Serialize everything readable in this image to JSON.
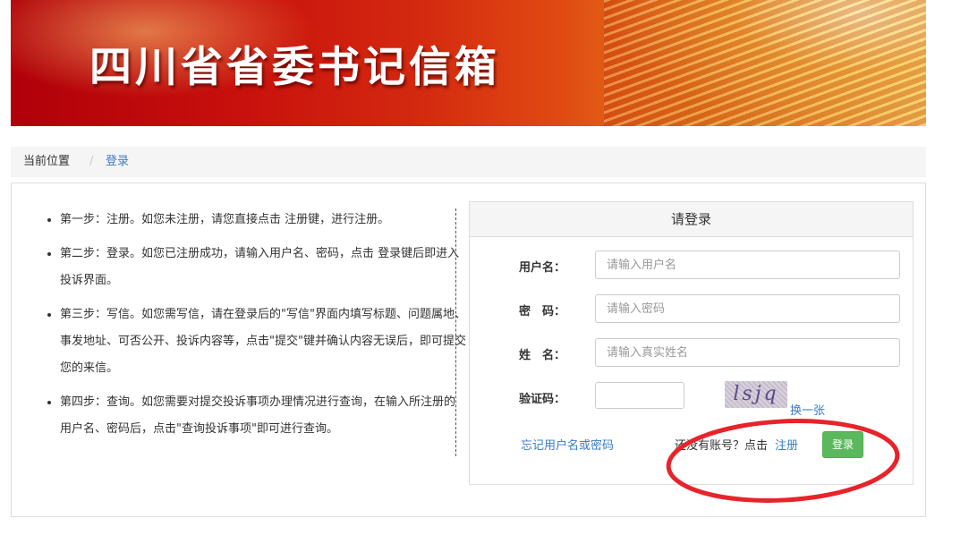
{
  "banner": {
    "title": "四川省省委书记信箱"
  },
  "breadcrumb": {
    "current_label": "当前位置",
    "separator": "/",
    "page": "登录"
  },
  "steps": [
    "第一步：注册。如您未注册，请您直接点击 注册键，进行注册。",
    "第二步：登录。如您已注册成功，请输入用户名、密码，点击 登录键后即进入投诉界面。",
    "第三步：写信。如您需写信，请在登录后的\"写信\"界面内填写标题、问题属地、事发地址、可否公开、投诉内容等，点击\"提交\"键并确认内容无误后，即可提交您的来信。",
    "第四步：查询。如您需要对提交投诉事项办理情况进行查询，在输入所注册的用户名、密码后，点击\"查询投诉事项\"即可进行查询。"
  ],
  "login": {
    "heading": "请登录",
    "username": {
      "label": "用户名：",
      "placeholder": "请输入用户名",
      "value": ""
    },
    "password": {
      "label": "密　码：",
      "placeholder": "请输入密码",
      "value": ""
    },
    "realname": {
      "label": "姓　名：",
      "placeholder": "请输入真实姓名",
      "value": ""
    },
    "captcha": {
      "label": "验证码：",
      "value": "",
      "image_text": "lsjq",
      "refresh_label": "换一张"
    },
    "forgot_link": "忘记用户名或密码",
    "no_account_text": "还没有账号？点击",
    "register_link": "注册",
    "submit_label": "登录"
  },
  "colors": {
    "link": "#3a7cc6",
    "button": "#5cb85c",
    "annotation_ring": "#e8232a",
    "banner_red": "#c8100c"
  }
}
